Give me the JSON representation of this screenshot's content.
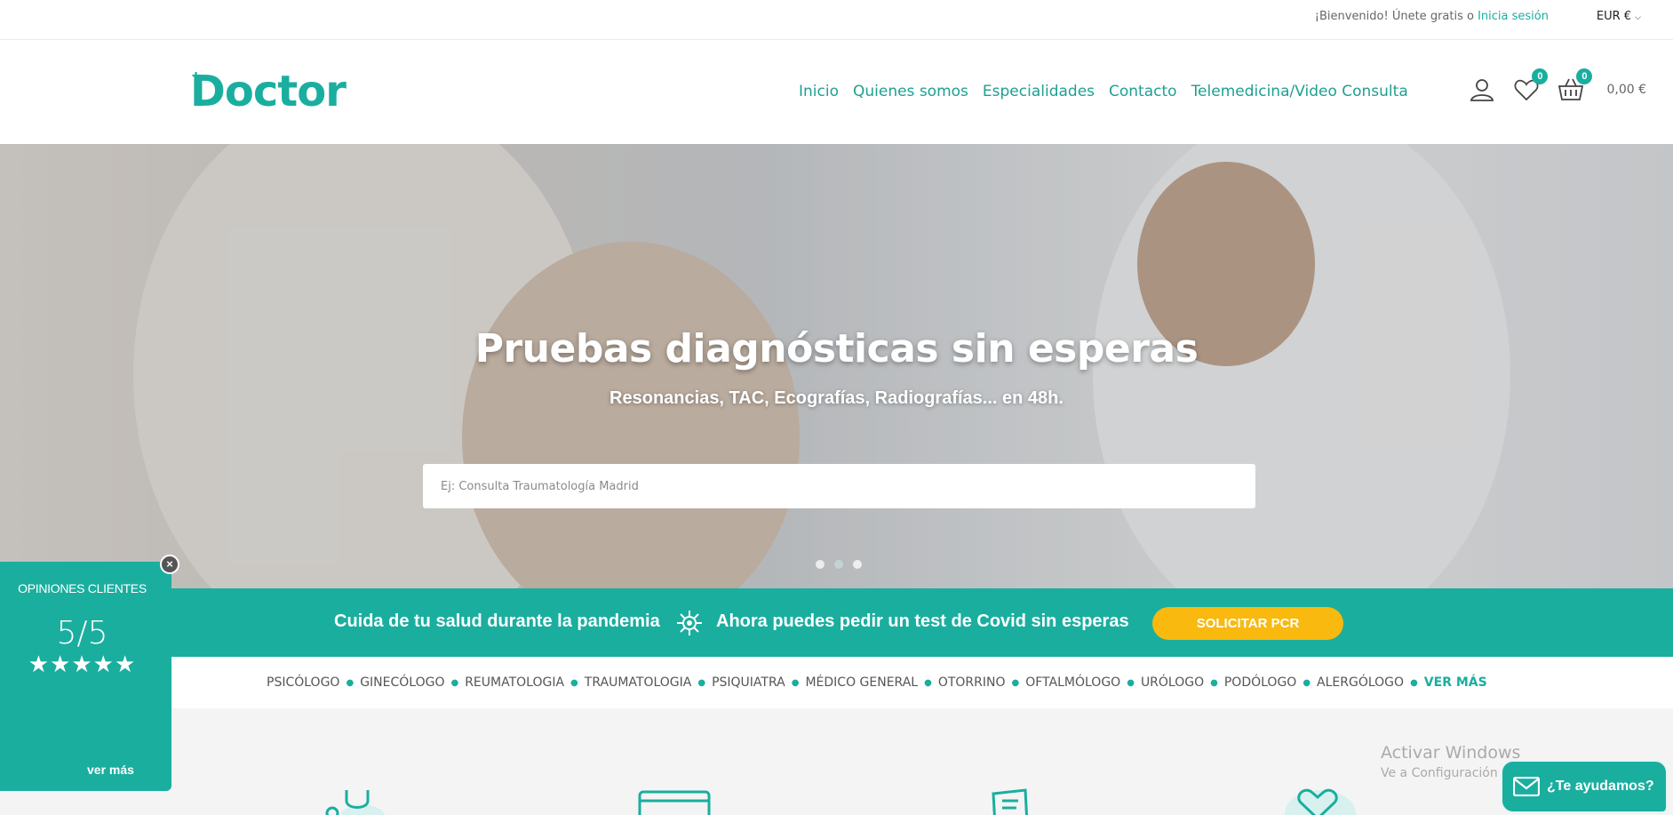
{
  "topbar": {
    "welcome_text": "¡Bienvenido! Únete gratis o",
    "login_link": "Inicia sesión",
    "currency": "EUR €"
  },
  "header": {
    "logo_text": "Doctor",
    "nav": [
      {
        "label": "Inicio"
      },
      {
        "label": "Quienes somos"
      },
      {
        "label": "Especialidades"
      },
      {
        "label": "Contacto"
      },
      {
        "label": "Telemedicina/Video Consulta"
      }
    ],
    "wishlist_count": "0",
    "cart_count": "0",
    "cart_total": "0,00 €"
  },
  "hero": {
    "title": "Pruebas diagnósticas sin esperas",
    "subtitle": "Resonancias, TAC, Ecografías, Radiografías... en 48h.",
    "search_placeholder": "Ej: Consulta Traumatología Madrid",
    "slide_count": 3,
    "active_slide": 2
  },
  "banner": {
    "text_left": "Cuida de tu salud durante la pandemia",
    "text_right": "Ahora puedes pedir un test de Covid sin esperas",
    "button_label": "SOLICITAR PCR",
    "accent": "#1aae9f",
    "button_color": "#f9b90e"
  },
  "specialties": {
    "items": [
      "PSICÓLOGO",
      "GINECÓLOGO",
      "REUMATOLOGIA",
      "TRAUMATOLOGIA",
      "PSIQUIATRA",
      "MÉDICO GENERAL",
      "OTORRINO",
      "OFTALMÓLOGO",
      "URÓLOGO",
      "PODÓLOGO",
      "ALERGÓLOGO"
    ],
    "more_label": "VER MÁS"
  },
  "reviews": {
    "title": "OPINIONES CLIENTES",
    "score": "5/5",
    "stars": "★★★★★",
    "more_link": "ver más"
  },
  "watermark": {
    "line1": "Activar Windows",
    "line2": "Ve a Configuración para activar Windows."
  },
  "help": {
    "label": "¿Te ayudamos?"
  }
}
